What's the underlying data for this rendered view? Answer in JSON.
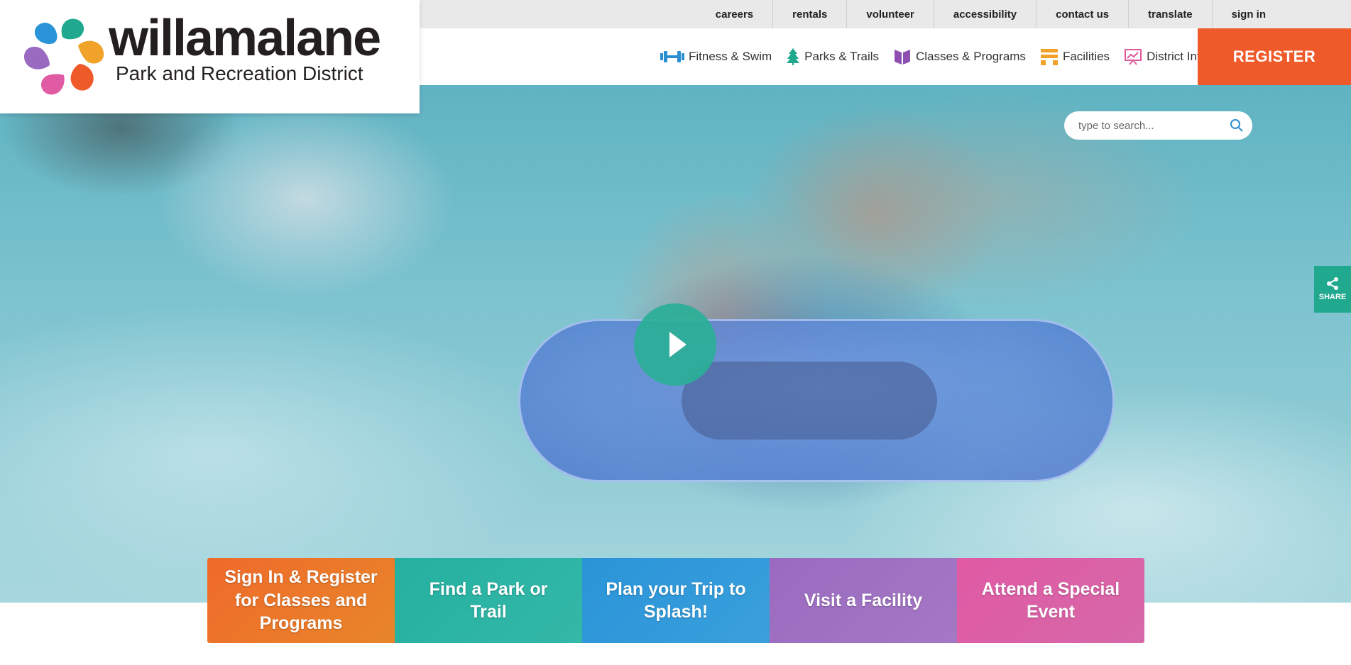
{
  "brand": {
    "name": "willamalane",
    "subtitle": "Park and Recreation District"
  },
  "utility_nav": [
    "careers",
    "rentals",
    "volunteer",
    "accessibility",
    "contact us",
    "translate",
    "sign in"
  ],
  "main_nav": [
    {
      "label": "Fitness & Swim",
      "icon": "dumbbell-icon",
      "color": "#2a8fd0"
    },
    {
      "label": "Parks & Trails",
      "icon": "tree-icon",
      "color": "#20a98f"
    },
    {
      "label": "Classes & Programs",
      "icon": "book-icon",
      "color": "#8e4fb0"
    },
    {
      "label": "Facilities",
      "icon": "building-icon",
      "color": "#f0a229"
    },
    {
      "label": "District Info",
      "icon": "presentation-icon",
      "color": "#e05a9c"
    }
  ],
  "register_label": "REGISTER",
  "search": {
    "placeholder": "type to search..."
  },
  "share_label": "SHARE",
  "tiles": [
    {
      "label": "Sign In & Register for Classes and Programs",
      "color": "#ef6a2a"
    },
    {
      "label": "Find a Park or Trail",
      "color": "#24b0a0"
    },
    {
      "label": "Plan your Trip to Splash!",
      "color": "#2a94d8"
    },
    {
      "label": "Visit a Facility",
      "color": "#9a6ac0"
    },
    {
      "label": "Attend a Special Event",
      "color": "#e05aa4"
    }
  ],
  "colors": {
    "accent_orange": "#ef5a2a",
    "accent_teal": "#20a98f",
    "utility_bg": "#e9e9e9"
  }
}
